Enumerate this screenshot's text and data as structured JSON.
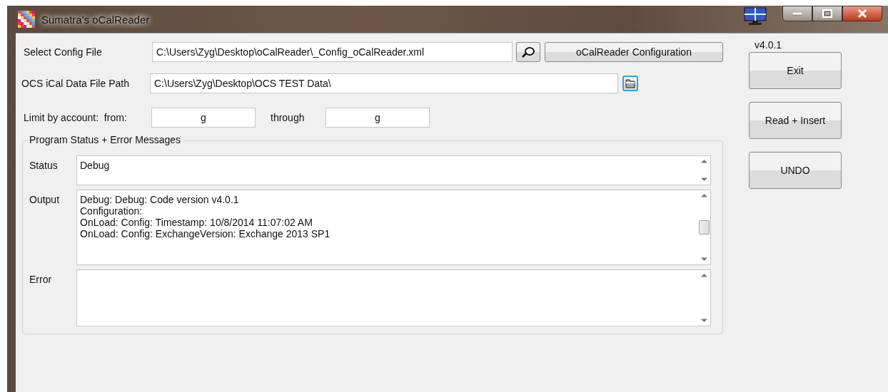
{
  "window": {
    "title": "Sumatra's oCalReader"
  },
  "config_file": {
    "label": "Select Config File",
    "value": "C:\\Users\\Zyg\\Desktop\\oCalReader\\_Config_oCalReader.xml",
    "configuration_button": "oCalReader Configuration"
  },
  "data_path": {
    "label": "OCS iCal Data File Path",
    "value": "C:\\Users\\Zyg\\Desktop\\OCS TEST Data\\"
  },
  "limit": {
    "label": "Limit by account:  from:",
    "from": "g",
    "through_label": "through",
    "through": "g"
  },
  "version": "v4.0.1",
  "buttons": [
    "Exit",
    "Read + Insert",
    "UNDO"
  ],
  "messages": {
    "title": "Program Status + Error Messages",
    "fields": [
      {
        "label": "Status",
        "lines": [
          "Debug"
        ],
        "kind": "status"
      },
      {
        "label": "Output",
        "lines": [
          "Debug: Debug: Code version v4.0.1",
          "Configuration:",
          "OnLoad: Config: Timestamp: 10/8/2014 11:07:02 AM",
          "OnLoad: Config: ExchangeVersion: Exchange 2013 SP1"
        ],
        "kind": "output"
      },
      {
        "label": "Error",
        "kind": "error"
      }
    ]
  }
}
